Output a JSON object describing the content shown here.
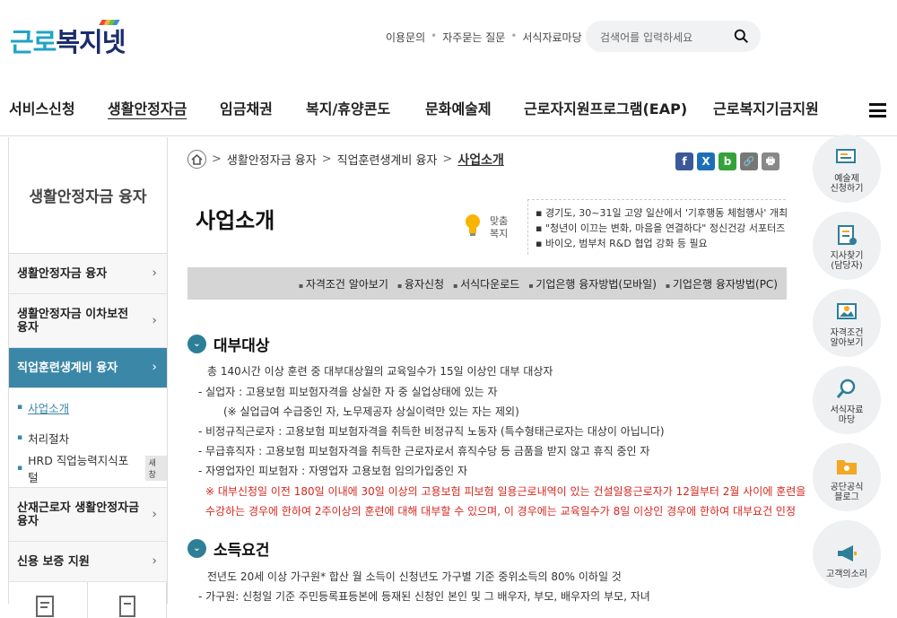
{
  "header": {
    "logo_part1": "근로",
    "logo_part2": "복지넷",
    "util": [
      "이용문의",
      "자주묻는 질문",
      "서식자료마당"
    ],
    "search_placeholder": "검색어를 입력하세요"
  },
  "gnb": [
    "서비스신청",
    "생활안정자금",
    "임금채권",
    "복지/휴양콘도",
    "문화예술제",
    "근로자지원프로그램(EAP)",
    "근로복지기금지원"
  ],
  "lnb": {
    "title": "생활안정자금 융자",
    "items": [
      "생활안정자금 융자",
      "생활안정자금 이차보전 융자",
      "직업훈련생계비 융자",
      "산재근로자 생활안정자금 융자",
      "신용 보증 지원"
    ],
    "subs": [
      "사업소개",
      "처리절차",
      "HRD 직업능력지식포털"
    ],
    "new_badge": "새창"
  },
  "breadcrumb": [
    "생활안정자금 융자",
    "직업훈련생계비 융자",
    "사업소개"
  ],
  "share": [
    "f",
    "X",
    "b",
    "🔗",
    "🖶"
  ],
  "page_title": "사업소개",
  "matchum": {
    "label1": "맞춤",
    "label2": "복지",
    "news": [
      "경기도, 30~31일 고양 일산에서 '기후행동 체험행사' 개최",
      "\"청년이 이끄는 변화, 마음을 연결하다\" 정신건강 서포터즈",
      "바이오, 범부처 R&D 협업 강화 등 필요"
    ]
  },
  "tabs": [
    "자격조건 알아보기",
    "융자신청",
    "서식다운로드",
    "기업은행 융자방법(모바일)",
    "기업은행 융자방법(PC)"
  ],
  "sections": [
    {
      "title": "대부대상",
      "lines": [
        "총 140시간 이상 훈련 중 대부대상월의 교육일수가 15일 이상인 대부 대상자",
        "- 실업자 : 고용보험 피보험자격을 상실한 자 중 실업상태에 있는 자",
        "(※ 실업급여 수급중인 자, 노무제공자 상실이력만 있는 자는 제외)",
        "- 비정규직근로자 : 고용보험 피보험자격을 취득한 비정규직 노동자 (특수형태근로자는 대상이 아닙니다)",
        "- 무급휴직자 : 고용보험 피보험자격을 취득한 근로자로서 휴직수당 등 금품을 받지 않고 휴직 중인 자",
        "- 자영업자인 피보험자 : 자영업자 고용보험 임의가입중인 자"
      ],
      "notes": [
        "※ 대부신청일 이전 180일 이내에 30일 이상의 고용보험 피보험 일용근로내역이 있는 건설일용근로자가 12월부터 2월 사이에 훈련을",
        "수강하는 경우에 한하여 2주이상의 훈련에 대해 대부할 수 있으며, 이 경우에는 교육일수가 8일 이상인 경우에 한하여 대부요건 인정"
      ]
    },
    {
      "title": "소득요건",
      "lines": [
        "전년도 20세 이상 가구원* 합산 월 소득이 신청년도 가구별 기준 중위소득의 80% 이하일 것",
        "- 가구원: 신청일 기준 주민등록표등본에 등재된 신청인 본인 및 그 배우자, 부모, 배우자의 부모, 자녀"
      ]
    }
  ],
  "quick": [
    [
      "예술제",
      "신청하기"
    ],
    [
      "지사찾기",
      "(담당자)"
    ],
    [
      "자격조건",
      "알아보기"
    ],
    [
      "서식자료",
      "마당"
    ],
    [
      "공단공식",
      "블로그"
    ],
    [
      "고객의소리",
      ""
    ]
  ]
}
